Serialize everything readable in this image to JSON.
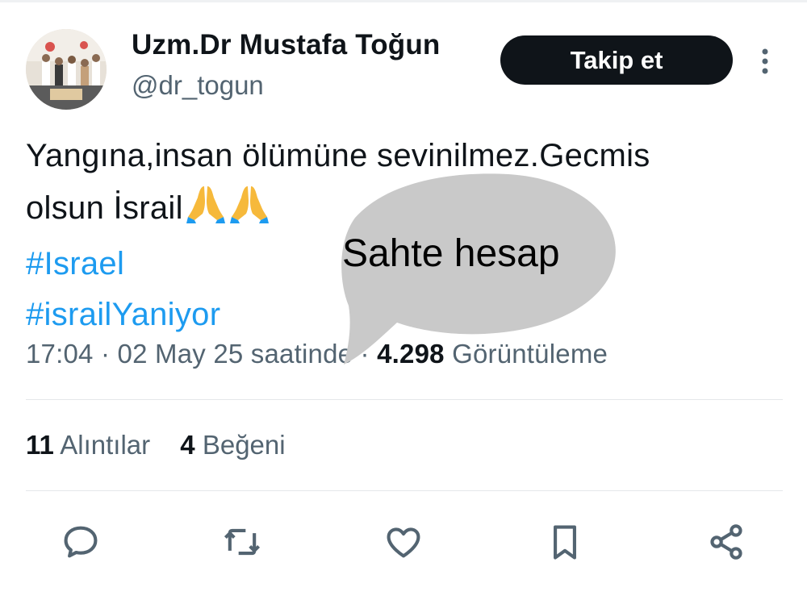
{
  "author": {
    "display_name": "Uzm.Dr Mustafa Toğun",
    "handle": "@dr_togun"
  },
  "follow_label": "Takip et",
  "tweet": {
    "line1": "Yangına,insan ölümüne sevinilmez.Gecmis",
    "line2": "olsun İsrail",
    "emoji": [
      "praying-hands",
      "praying-hands"
    ],
    "hashtag1": "#Israel",
    "hashtag2": "#israilYaniyor"
  },
  "meta": {
    "time": "17:04",
    "sep1": "·",
    "date": "02 May 25 saatinde",
    "sep2": "·",
    "views_count": "4.298",
    "views_label": "Görüntüleme"
  },
  "stats": {
    "quotes_count": "11",
    "quotes_label": "Alıntılar",
    "likes_count": "4",
    "likes_label": "Beğeni"
  },
  "actions": [
    "reply-icon",
    "retweet-icon",
    "like-icon",
    "bookmark-icon",
    "share-icon"
  ],
  "overlay": {
    "text": "Sahte hesap",
    "color": "#c9c9c9"
  },
  "colors": {
    "text": "#0f1419",
    "secondary": "#536471",
    "link": "#1d9bf0",
    "button": "#0f1419"
  }
}
